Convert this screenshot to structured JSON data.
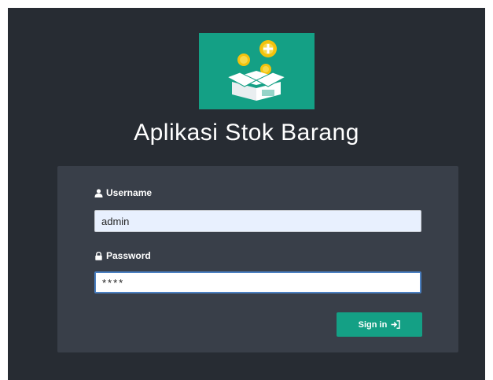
{
  "app": {
    "title": "Aplikasi Stok Barang"
  },
  "login": {
    "username_label": "Username",
    "username_value": "admin",
    "password_label": "Password",
    "password_value": "****",
    "submit_label": "Sign in"
  },
  "icons": {
    "logo": "box-with-coins-logo",
    "username": "user-icon",
    "password": "lock-icon",
    "submit": "sign-in-icon"
  },
  "colors": {
    "background": "#272c33",
    "card": "#393f49",
    "accent": "#14a085",
    "username_input_bg": "#e8f0fe",
    "focus_border": "#4a7fc1"
  }
}
